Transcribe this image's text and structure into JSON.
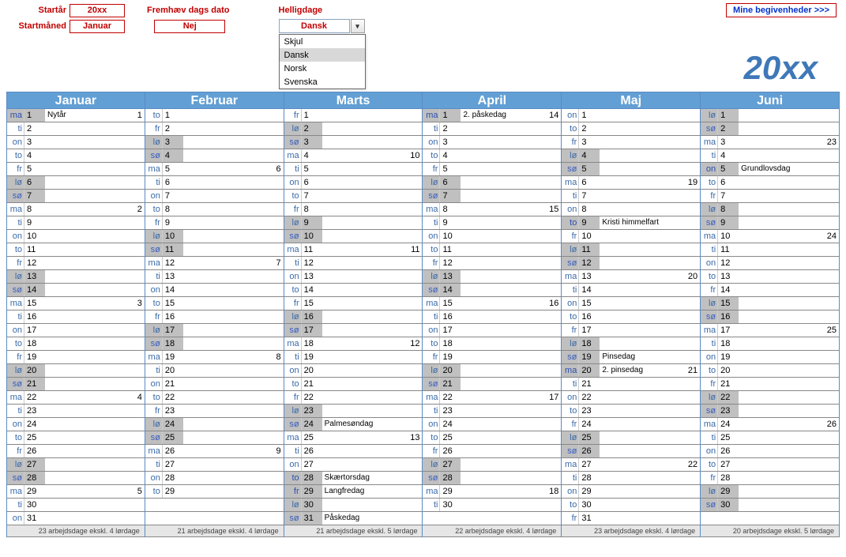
{
  "controls": {
    "startYearLabel": "Startår",
    "startYearValue": "20xx",
    "startMonthLabel": "Startmåned",
    "startMonthValue": "Januar",
    "highlightLabel": "Fremhæv dags dato",
    "highlightValue": "Nej",
    "holidaysLabel": "Helligdage",
    "holidaysValue": "Dansk",
    "holidaysOptions": [
      "Skjul",
      "Dansk",
      "Norsk",
      "Svenska"
    ],
    "holidaysSelected": "Dansk",
    "eventsButton": "Mine begivenheder >>>"
  },
  "bigYear": "20xx",
  "months": [
    {
      "name": "Januar",
      "footer": "23 arbejdsdage ekskl. 4 lørdage",
      "days": [
        {
          "dow": "ma",
          "n": 1,
          "t": "h",
          "lbl": "Nytår",
          "wk": 1
        },
        {
          "dow": "ti",
          "n": 2
        },
        {
          "dow": "on",
          "n": 3
        },
        {
          "dow": "to",
          "n": 4
        },
        {
          "dow": "fr",
          "n": 5
        },
        {
          "dow": "lø",
          "n": 6,
          "t": "sa"
        },
        {
          "dow": "sø",
          "n": 7,
          "t": "su"
        },
        {
          "dow": "ma",
          "n": 8,
          "wk": 2
        },
        {
          "dow": "ti",
          "n": 9
        },
        {
          "dow": "on",
          "n": 10
        },
        {
          "dow": "to",
          "n": 11
        },
        {
          "dow": "fr",
          "n": 12
        },
        {
          "dow": "lø",
          "n": 13,
          "t": "sa"
        },
        {
          "dow": "sø",
          "n": 14,
          "t": "su"
        },
        {
          "dow": "ma",
          "n": 15,
          "wk": 3
        },
        {
          "dow": "ti",
          "n": 16
        },
        {
          "dow": "on",
          "n": 17
        },
        {
          "dow": "to",
          "n": 18
        },
        {
          "dow": "fr",
          "n": 19
        },
        {
          "dow": "lø",
          "n": 20,
          "t": "sa"
        },
        {
          "dow": "sø",
          "n": 21,
          "t": "su"
        },
        {
          "dow": "ma",
          "n": 22,
          "wk": 4
        },
        {
          "dow": "ti",
          "n": 23
        },
        {
          "dow": "on",
          "n": 24
        },
        {
          "dow": "to",
          "n": 25
        },
        {
          "dow": "fr",
          "n": 26
        },
        {
          "dow": "lø",
          "n": 27,
          "t": "sa"
        },
        {
          "dow": "sø",
          "n": 28,
          "t": "su"
        },
        {
          "dow": "ma",
          "n": 29,
          "wk": 5
        },
        {
          "dow": "ti",
          "n": 30
        },
        {
          "dow": "on",
          "n": 31
        }
      ]
    },
    {
      "name": "Februar",
      "footer": "21 arbejdsdage ekskl. 4 lørdage",
      "days": [
        {
          "dow": "to",
          "n": 1
        },
        {
          "dow": "fr",
          "n": 2
        },
        {
          "dow": "lø",
          "n": 3,
          "t": "sa"
        },
        {
          "dow": "sø",
          "n": 4,
          "t": "su"
        },
        {
          "dow": "ma",
          "n": 5,
          "wk": 6
        },
        {
          "dow": "ti",
          "n": 6
        },
        {
          "dow": "on",
          "n": 7
        },
        {
          "dow": "to",
          "n": 8
        },
        {
          "dow": "fr",
          "n": 9
        },
        {
          "dow": "lø",
          "n": 10,
          "t": "sa"
        },
        {
          "dow": "sø",
          "n": 11,
          "t": "su"
        },
        {
          "dow": "ma",
          "n": 12,
          "wk": 7
        },
        {
          "dow": "ti",
          "n": 13
        },
        {
          "dow": "on",
          "n": 14
        },
        {
          "dow": "to",
          "n": 15
        },
        {
          "dow": "fr",
          "n": 16
        },
        {
          "dow": "lø",
          "n": 17,
          "t": "sa"
        },
        {
          "dow": "sø",
          "n": 18,
          "t": "su"
        },
        {
          "dow": "ma",
          "n": 19,
          "wk": 8
        },
        {
          "dow": "ti",
          "n": 20
        },
        {
          "dow": "on",
          "n": 21
        },
        {
          "dow": "to",
          "n": 22
        },
        {
          "dow": "fr",
          "n": 23
        },
        {
          "dow": "lø",
          "n": 24,
          "t": "sa"
        },
        {
          "dow": "sø",
          "n": 25,
          "t": "su"
        },
        {
          "dow": "ma",
          "n": 26,
          "wk": 9
        },
        {
          "dow": "ti",
          "n": 27
        },
        {
          "dow": "on",
          "n": 28
        },
        {
          "dow": "to",
          "n": 29
        }
      ]
    },
    {
      "name": "Marts",
      "footer": "21 arbejdsdage ekskl. 5 lørdage",
      "days": [
        {
          "dow": "fr",
          "n": 1
        },
        {
          "dow": "lø",
          "n": 2,
          "t": "sa"
        },
        {
          "dow": "sø",
          "n": 3,
          "t": "su"
        },
        {
          "dow": "ma",
          "n": 4,
          "wk": 10
        },
        {
          "dow": "ti",
          "n": 5
        },
        {
          "dow": "on",
          "n": 6
        },
        {
          "dow": "to",
          "n": 7
        },
        {
          "dow": "fr",
          "n": 8
        },
        {
          "dow": "lø",
          "n": 9,
          "t": "sa"
        },
        {
          "dow": "sø",
          "n": 10,
          "t": "su"
        },
        {
          "dow": "ma",
          "n": 11,
          "wk": 11
        },
        {
          "dow": "ti",
          "n": 12
        },
        {
          "dow": "on",
          "n": 13
        },
        {
          "dow": "to",
          "n": 14
        },
        {
          "dow": "fr",
          "n": 15
        },
        {
          "dow": "lø",
          "n": 16,
          "t": "sa"
        },
        {
          "dow": "sø",
          "n": 17,
          "t": "su"
        },
        {
          "dow": "ma",
          "n": 18,
          "wk": 12
        },
        {
          "dow": "ti",
          "n": 19
        },
        {
          "dow": "on",
          "n": 20
        },
        {
          "dow": "to",
          "n": 21
        },
        {
          "dow": "fr",
          "n": 22
        },
        {
          "dow": "lø",
          "n": 23,
          "t": "sa"
        },
        {
          "dow": "sø",
          "n": 24,
          "t": "su",
          "lbl": "Palmesøndag"
        },
        {
          "dow": "ma",
          "n": 25,
          "wk": 13
        },
        {
          "dow": "ti",
          "n": 26
        },
        {
          "dow": "on",
          "n": 27
        },
        {
          "dow": "to",
          "n": 28,
          "t": "h",
          "lbl": "Skærtorsdag"
        },
        {
          "dow": "fr",
          "n": 29,
          "t": "h",
          "lbl": "Langfredag"
        },
        {
          "dow": "lø",
          "n": 30,
          "t": "sa"
        },
        {
          "dow": "sø",
          "n": 31,
          "t": "su",
          "lbl": "Påskedag"
        }
      ]
    },
    {
      "name": "April",
      "footer": "22 arbejdsdage ekskl. 4 lørdage",
      "days": [
        {
          "dow": "ma",
          "n": 1,
          "t": "h",
          "lbl": "2. påskedag",
          "wk": 14
        },
        {
          "dow": "ti",
          "n": 2
        },
        {
          "dow": "on",
          "n": 3
        },
        {
          "dow": "to",
          "n": 4
        },
        {
          "dow": "fr",
          "n": 5
        },
        {
          "dow": "lø",
          "n": 6,
          "t": "sa"
        },
        {
          "dow": "sø",
          "n": 7,
          "t": "su"
        },
        {
          "dow": "ma",
          "n": 8,
          "wk": 15
        },
        {
          "dow": "ti",
          "n": 9
        },
        {
          "dow": "on",
          "n": 10
        },
        {
          "dow": "to",
          "n": 11
        },
        {
          "dow": "fr",
          "n": 12
        },
        {
          "dow": "lø",
          "n": 13,
          "t": "sa"
        },
        {
          "dow": "sø",
          "n": 14,
          "t": "su"
        },
        {
          "dow": "ma",
          "n": 15,
          "wk": 16
        },
        {
          "dow": "ti",
          "n": 16
        },
        {
          "dow": "on",
          "n": 17
        },
        {
          "dow": "to",
          "n": 18
        },
        {
          "dow": "fr",
          "n": 19
        },
        {
          "dow": "lø",
          "n": 20,
          "t": "sa"
        },
        {
          "dow": "sø",
          "n": 21,
          "t": "su"
        },
        {
          "dow": "ma",
          "n": 22,
          "wk": 17
        },
        {
          "dow": "ti",
          "n": 23
        },
        {
          "dow": "on",
          "n": 24
        },
        {
          "dow": "to",
          "n": 25
        },
        {
          "dow": "fr",
          "n": 26
        },
        {
          "dow": "lø",
          "n": 27,
          "t": "sa"
        },
        {
          "dow": "sø",
          "n": 28,
          "t": "su"
        },
        {
          "dow": "ma",
          "n": 29,
          "wk": 18
        },
        {
          "dow": "ti",
          "n": 30
        }
      ]
    },
    {
      "name": "Maj",
      "footer": "23 arbejdsdage ekskl. 4 lørdage",
      "days": [
        {
          "dow": "on",
          "n": 1
        },
        {
          "dow": "to",
          "n": 2
        },
        {
          "dow": "fr",
          "n": 3
        },
        {
          "dow": "lø",
          "n": 4,
          "t": "sa"
        },
        {
          "dow": "sø",
          "n": 5,
          "t": "su"
        },
        {
          "dow": "ma",
          "n": 6,
          "wk": 19
        },
        {
          "dow": "ti",
          "n": 7
        },
        {
          "dow": "on",
          "n": 8
        },
        {
          "dow": "to",
          "n": 9,
          "t": "h",
          "lbl": "Kristi himmelfart"
        },
        {
          "dow": "fr",
          "n": 10
        },
        {
          "dow": "lø",
          "n": 11,
          "t": "sa"
        },
        {
          "dow": "sø",
          "n": 12,
          "t": "su"
        },
        {
          "dow": "ma",
          "n": 13,
          "wk": 20
        },
        {
          "dow": "ti",
          "n": 14
        },
        {
          "dow": "on",
          "n": 15
        },
        {
          "dow": "to",
          "n": 16
        },
        {
          "dow": "fr",
          "n": 17
        },
        {
          "dow": "lø",
          "n": 18,
          "t": "sa"
        },
        {
          "dow": "sø",
          "n": 19,
          "t": "su",
          "lbl": "Pinsedag"
        },
        {
          "dow": "ma",
          "n": 20,
          "t": "h",
          "lbl": "2. pinsedag",
          "wk": 21
        },
        {
          "dow": "ti",
          "n": 21
        },
        {
          "dow": "on",
          "n": 22
        },
        {
          "dow": "to",
          "n": 23
        },
        {
          "dow": "fr",
          "n": 24
        },
        {
          "dow": "lø",
          "n": 25,
          "t": "sa"
        },
        {
          "dow": "sø",
          "n": 26,
          "t": "su"
        },
        {
          "dow": "ma",
          "n": 27,
          "wk": 22
        },
        {
          "dow": "ti",
          "n": 28
        },
        {
          "dow": "on",
          "n": 29
        },
        {
          "dow": "to",
          "n": 30
        },
        {
          "dow": "fr",
          "n": 31
        }
      ]
    },
    {
      "name": "Juni",
      "footer": "20 arbejdsdage ekskl. 5 lørdage",
      "days": [
        {
          "dow": "lø",
          "n": 1,
          "t": "sa"
        },
        {
          "dow": "sø",
          "n": 2,
          "t": "su"
        },
        {
          "dow": "ma",
          "n": 3,
          "wk": 23
        },
        {
          "dow": "ti",
          "n": 4
        },
        {
          "dow": "on",
          "n": 5,
          "t": "h",
          "lbl": "Grundlovsdag"
        },
        {
          "dow": "to",
          "n": 6
        },
        {
          "dow": "fr",
          "n": 7
        },
        {
          "dow": "lø",
          "n": 8,
          "t": "sa"
        },
        {
          "dow": "sø",
          "n": 9,
          "t": "su"
        },
        {
          "dow": "ma",
          "n": 10,
          "wk": 24
        },
        {
          "dow": "ti",
          "n": 11
        },
        {
          "dow": "on",
          "n": 12
        },
        {
          "dow": "to",
          "n": 13
        },
        {
          "dow": "fr",
          "n": 14
        },
        {
          "dow": "lø",
          "n": 15,
          "t": "sa"
        },
        {
          "dow": "sø",
          "n": 16,
          "t": "su"
        },
        {
          "dow": "ma",
          "n": 17,
          "wk": 25
        },
        {
          "dow": "ti",
          "n": 18
        },
        {
          "dow": "on",
          "n": 19
        },
        {
          "dow": "to",
          "n": 20
        },
        {
          "dow": "fr",
          "n": 21
        },
        {
          "dow": "lø",
          "n": 22,
          "t": "sa"
        },
        {
          "dow": "sø",
          "n": 23,
          "t": "su"
        },
        {
          "dow": "ma",
          "n": 24,
          "wk": 26
        },
        {
          "dow": "ti",
          "n": 25
        },
        {
          "dow": "on",
          "n": 26
        },
        {
          "dow": "to",
          "n": 27
        },
        {
          "dow": "fr",
          "n": 28
        },
        {
          "dow": "lø",
          "n": 29,
          "t": "sa"
        },
        {
          "dow": "sø",
          "n": 30,
          "t": "su"
        }
      ]
    }
  ]
}
